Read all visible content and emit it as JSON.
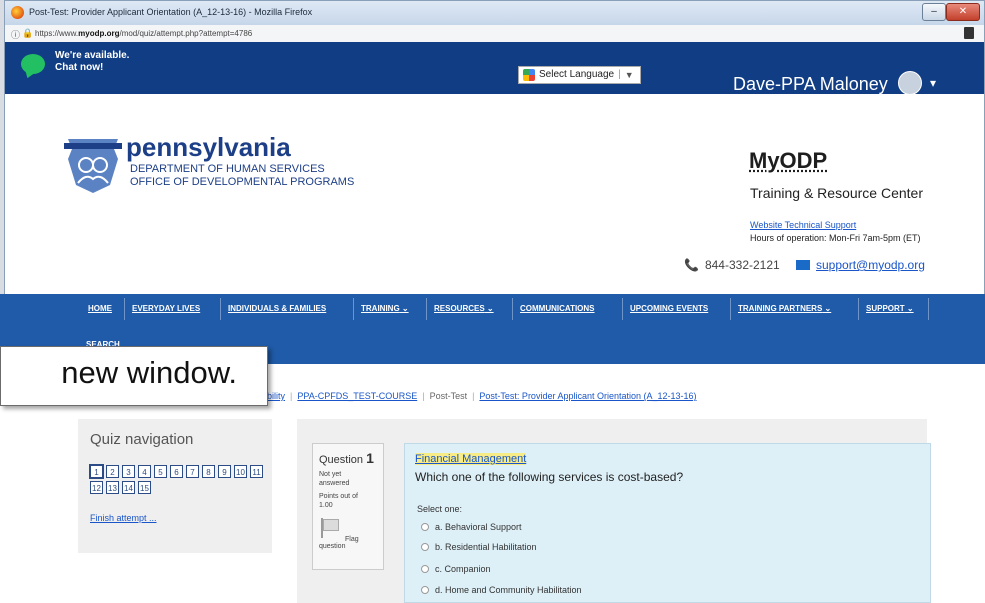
{
  "window": {
    "title": "Post-Test: Provider Applicant Orientation (A_12-13-16) - Mozilla Firefox",
    "url_prefix": "https://www.",
    "url_domain": "myodp.org",
    "url_path": "/mod/quiz/attempt.php?attempt=4786"
  },
  "topbar": {
    "chat_line1": "We're available.",
    "chat_line2": "Chat now!",
    "language_label": "Select Language",
    "user_name": "Dave-PPA Maloney"
  },
  "header": {
    "state_name": "pennsylvania",
    "dept_line1": "DEPARTMENT OF HUMAN SERVICES",
    "dept_line2": "OFFICE OF DEVELOPMENTAL PROGRAMS",
    "site_title": "MyODP",
    "site_subtitle": "Training & Resource Center",
    "tech_support_link": "Website Technical Support",
    "hours": "Hours of operation: Mon-Fri 7am-5pm (ET)",
    "phone": "844-332-2121",
    "email": "support@myodp.org"
  },
  "nav": {
    "items": [
      "HOME",
      "EVERYDAY LIVES",
      "INDIVIDUALS & FAMILIES",
      "TRAINING",
      "RESOURCES",
      "COMMUNICATIONS",
      "UPCOMING EVENTS",
      "TRAINING PARTNERS",
      "SUPPORT"
    ],
    "search": "SEARCH"
  },
  "breadcrumb": {
    "part1": "ability",
    "part2": "PPA-CPFDS_TEST-COURSE",
    "part3": "Post-Test",
    "part4": "Post-Test: Provider Applicant Orientation (A_12-13-16)"
  },
  "quiz_nav": {
    "heading": "Quiz navigation",
    "questions": [
      "1",
      "2",
      "3",
      "4",
      "5",
      "6",
      "7",
      "8",
      "9",
      "10",
      "11",
      "12",
      "13",
      "14",
      "15"
    ],
    "finish": "Finish attempt ..."
  },
  "question": {
    "label": "Question",
    "number": "1",
    "status_line1": "Not yet",
    "status_line2": "answered",
    "points_line1": "Points out of",
    "points_line2": "1.00",
    "flag_label": "Flag",
    "flag_label2": "question",
    "category": "Financial Management",
    "text": "Which one of the following services is cost-based?",
    "select_one": "Select one:",
    "options": [
      "a. Behavioral Support",
      "b. Residential Habilitation",
      "c. Companion",
      "d. Home and Community Habilitation"
    ]
  },
  "callout": {
    "text": "new window."
  }
}
